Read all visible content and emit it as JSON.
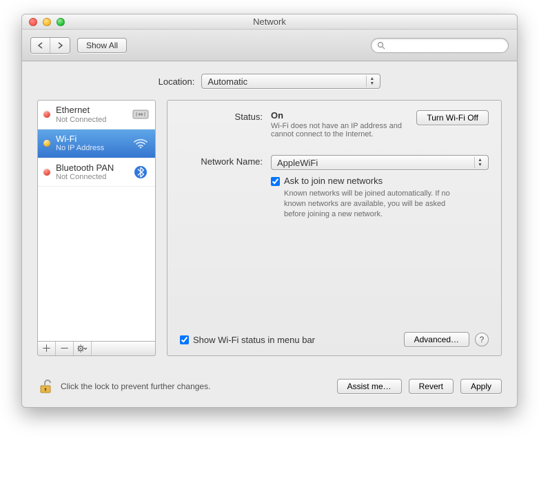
{
  "window": {
    "title": "Network"
  },
  "toolbar": {
    "show_all": "Show All",
    "search_placeholder": ""
  },
  "location": {
    "label": "Location:",
    "value": "Automatic"
  },
  "sidebar": {
    "items": [
      {
        "name": "Ethernet",
        "status": "Not Connected",
        "dot": "red",
        "icon": "ethernet",
        "selected": false
      },
      {
        "name": "Wi-Fi",
        "status": "No IP Address",
        "dot": "yellow",
        "icon": "wifi",
        "selected": true
      },
      {
        "name": "Bluetooth PAN",
        "status": "Not Connected",
        "dot": "red",
        "icon": "bluetooth",
        "selected": false
      }
    ]
  },
  "detail": {
    "status_label": "Status:",
    "status_value": "On",
    "wifi_off_btn": "Turn Wi-Fi Off",
    "status_note": "Wi-Fi does not have an IP address and cannot connect to the Internet.",
    "network_name_label": "Network Name:",
    "network_name_value": "AppleWiFi",
    "ask_join": "Ask to join new networks",
    "ask_join_note": "Known networks will be joined automatically. If no known networks are available, you will be asked before joining a new network.",
    "show_status": "Show Wi-Fi status in menu bar",
    "advanced_btn": "Advanced…"
  },
  "footer": {
    "lock_text": "Click the lock to prevent further changes.",
    "assist_btn": "Assist me…",
    "revert_btn": "Revert",
    "apply_btn": "Apply"
  }
}
